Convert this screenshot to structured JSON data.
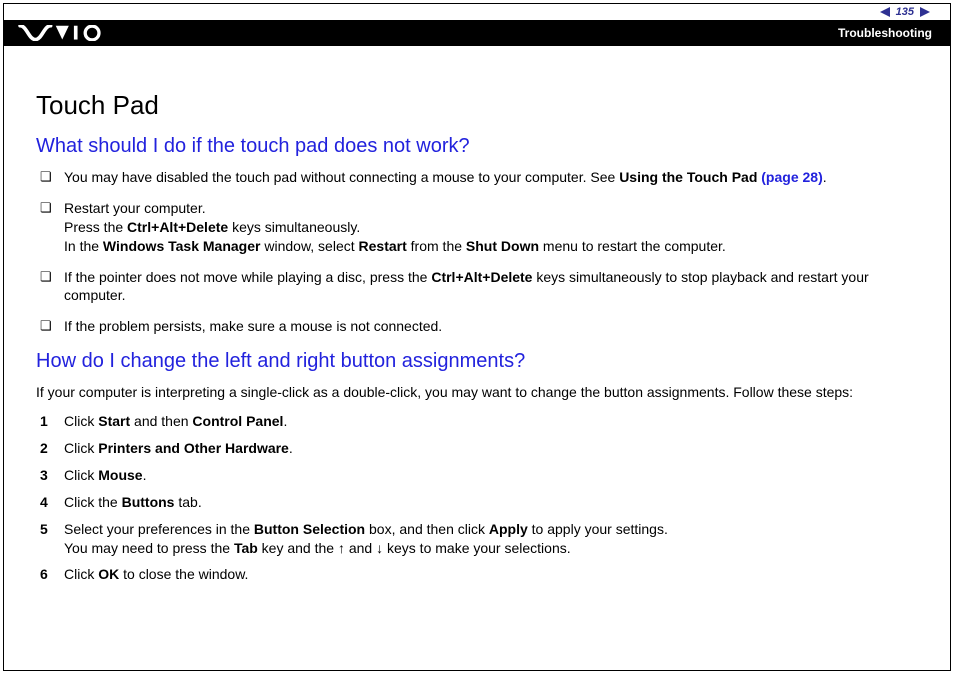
{
  "header": {
    "page_number": "135",
    "section": "Troubleshooting"
  },
  "content": {
    "title": "Touch Pad",
    "q1": {
      "heading": "What should I do if the touch pad does not work?",
      "items": [
        {
          "pre": "You may have disabled the touch pad without connecting a mouse to your computer. See ",
          "bold1": "Using the Touch Pad ",
          "link": "(page 28)",
          "post": "."
        },
        {
          "l1_pre": "Restart your computer.",
          "l2_pre": "Press the ",
          "l2_b": "Ctrl+Alt+Delete",
          "l2_post": " keys simultaneously.",
          "l3_pre": "In the ",
          "l3_b1": "Windows Task Manager",
          "l3_mid1": " window, select ",
          "l3_b2": "Restart",
          "l3_mid2": " from the ",
          "l3_b3": "Shut Down",
          "l3_post": " menu to restart the computer."
        },
        {
          "pre": "If the pointer does not move while playing a disc, press the ",
          "bold1": "Ctrl+Alt+Delete",
          "post": " keys simultaneously to stop playback and restart your computer."
        },
        {
          "text": "If the problem persists, make sure a mouse is not connected."
        }
      ]
    },
    "q2": {
      "heading": "How do I change the left and right button assignments?",
      "intro": "If your computer is interpreting a single-click as a double-click, you may want to change the button assignments. Follow these steps:",
      "steps": [
        {
          "pre": "Click ",
          "b1": "Start",
          "mid": " and then ",
          "b2": "Control Panel",
          "post": "."
        },
        {
          "pre": "Click ",
          "b1": "Printers and Other Hardware",
          "post": "."
        },
        {
          "pre": "Click ",
          "b1": "Mouse",
          "post": "."
        },
        {
          "pre": "Click the ",
          "b1": "Buttons",
          "post": " tab."
        },
        {
          "l1_pre": "Select your preferences in the ",
          "l1_b1": "Button Selection",
          "l1_mid": " box, and then click ",
          "l1_b2": "Apply",
          "l1_post": " to apply your settings.",
          "l2_pre": "You may need to press the ",
          "l2_b1": "Tab",
          "l2_mid1": " key and the ",
          "l2_mid2": " and ",
          "l2_post": " keys to make your selections."
        },
        {
          "pre": "Click ",
          "b1": "OK",
          "post": " to close the window."
        }
      ]
    }
  }
}
